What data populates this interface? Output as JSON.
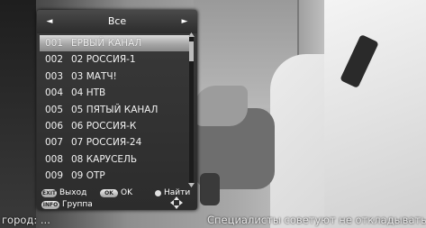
{
  "panel": {
    "header": {
      "title": "Все",
      "left_arrow": "◄",
      "right_arrow": "►"
    },
    "channels": [
      {
        "num": "001",
        "name": "ЕРВЫЙ КАНАЛ",
        "selected": true
      },
      {
        "num": "002",
        "name": "02 РОССИЯ-1",
        "selected": false
      },
      {
        "num": "003",
        "name": "03 МАТЧ!",
        "selected": false
      },
      {
        "num": "004",
        "name": "04 НТВ",
        "selected": false
      },
      {
        "num": "005",
        "name": "05 ПЯТЫЙ КАНАЛ",
        "selected": false
      },
      {
        "num": "006",
        "name": "06 РОССИЯ-К",
        "selected": false
      },
      {
        "num": "007",
        "name": "07 РОССИЯ-24",
        "selected": false
      },
      {
        "num": "008",
        "name": "08 КАРУСЕЛЬ",
        "selected": false
      },
      {
        "num": "009",
        "name": "09 ОТР",
        "selected": false
      }
    ],
    "footer": {
      "exit_key": "EXIT",
      "exit_label": "Выход",
      "ok_key": "OK",
      "ok_label": "OK",
      "find_label": "Найти",
      "info_key": "INFO",
      "group_label": "Группа"
    }
  },
  "ticker": {
    "left": "город: ...",
    "right": "Специалисты советуют не откладывать"
  },
  "colors": {
    "panel_bg": "#2c2c2c",
    "selection": "#a6a6a6",
    "text": "#f2f2f2"
  },
  "icons": [
    "arrow-left-icon",
    "arrow-right-icon",
    "find-dot-icon",
    "navigation-pad-icon",
    "scroll-up-icon",
    "scroll-down-icon"
  ]
}
